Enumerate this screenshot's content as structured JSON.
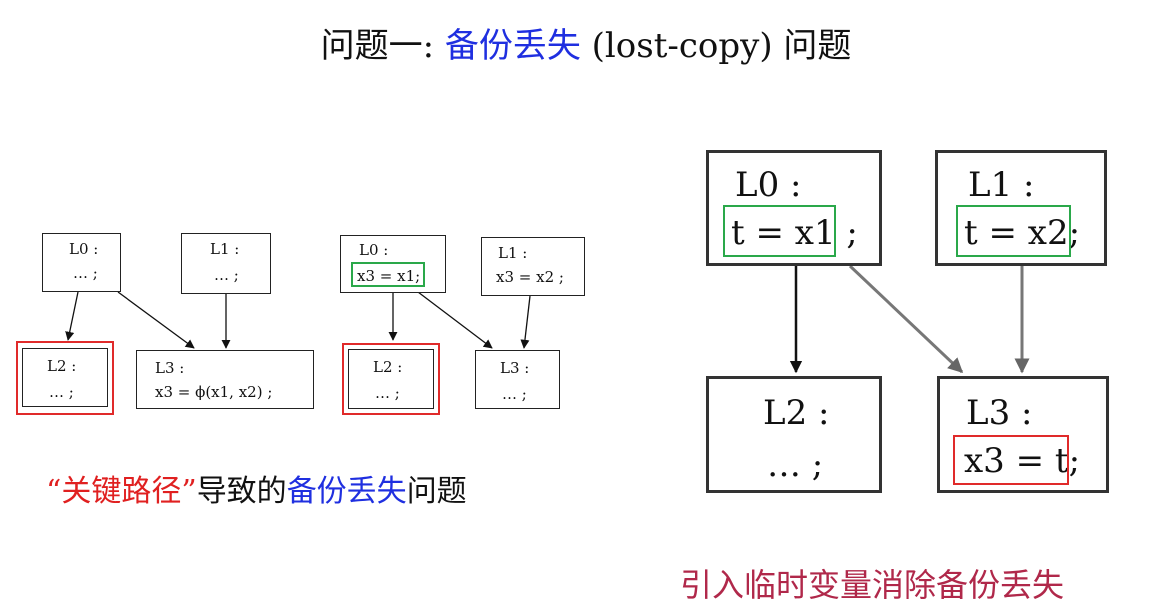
{
  "title": {
    "prefix": "问题一: ",
    "highlight": "备份丢失",
    "suffix": " (lost-copy) 问题",
    "highlight_color": "#1f2fe0"
  },
  "left_diagram": {
    "nodes": {
      "L0": {
        "label": "L0 :",
        "body": "… ;"
      },
      "L1": {
        "label": "L1 :",
        "body": "… ;"
      },
      "L2": {
        "label": "L2 :",
        "body": "… ;"
      },
      "L3": {
        "label": "L3 :",
        "body": "x3 = ϕ(x1, x2) ;"
      }
    }
  },
  "middle_diagram": {
    "nodes": {
      "L0": {
        "label": "L0 :",
        "body": "x3 = x1",
        "body_suffix": ";"
      },
      "L1": {
        "label": "L1 :",
        "body": "x3 = x2 ;"
      },
      "L2": {
        "label": "L2 :",
        "body": "… ;"
      },
      "L3": {
        "label": "L3 :",
        "body": "… ;"
      }
    }
  },
  "right_diagram": {
    "nodes": {
      "L0": {
        "label": "L0 :",
        "body": "t = x1",
        "body_suffix": ";"
      },
      "L1": {
        "label": "L1 :",
        "body": "t = x2",
        "body_suffix": ";"
      },
      "L2": {
        "label": "L2 :",
        "body": "… ;"
      },
      "L3": {
        "label": "L3 :",
        "body": "x3 = t",
        "body_suffix": ";"
      }
    }
  },
  "captions": {
    "left": {
      "quote_part": "“关键路径”",
      "mid_part": "导致的",
      "blue_part": "备份丢失",
      "end_part": "问题"
    },
    "right": "引入临时变量消除备份丢失"
  },
  "colors": {
    "green_highlight": "#2aa84a",
    "red_highlight": "#e02a2a",
    "right_caption": "#b0284a"
  }
}
